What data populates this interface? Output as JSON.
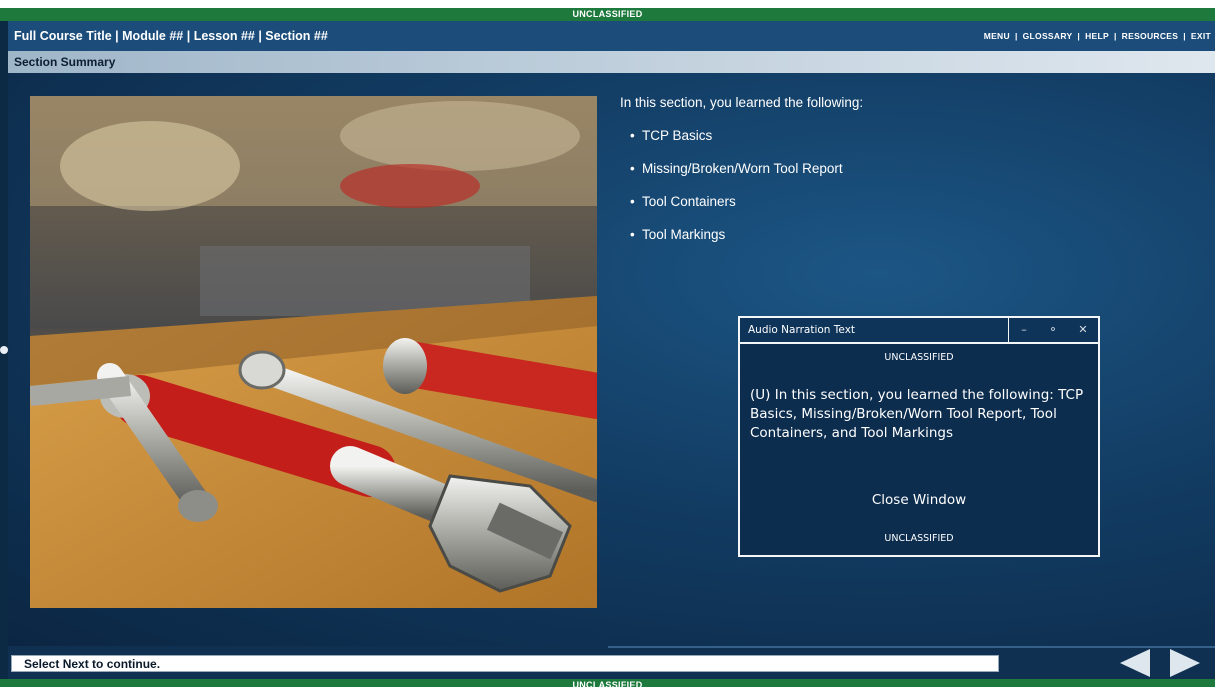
{
  "classification": {
    "top": "UNCLASSIFIED",
    "bottom": "UNCLASSIFIED"
  },
  "header": {
    "course_title": "Full Course Title | Module ## | Lesson ## | Section ##",
    "nav": [
      "MENU",
      "GLOSSARY",
      "HELP",
      "RESOURCES",
      "EXIT"
    ],
    "nav_separator": "|"
  },
  "section": {
    "title": "Section Summary"
  },
  "content": {
    "intro": "In this section, you learned the following:",
    "bullets": [
      "TCP Basics",
      "Missing/Broken/Worn Tool Report",
      "Tool Containers",
      "Tool Markings"
    ],
    "bullet_glyph": "•"
  },
  "dialog": {
    "title": "Audio Narration Text",
    "classification_top": "UNCLASSIFIED",
    "classification_bottom": "UNCLASSIFIED",
    "body": "(U) In this section, you learned the following: TCP Basics, Missing/Broken/Worn Tool Report, Tool Containers, and Tool Markings",
    "close_label": "Close Window",
    "minimize_glyph": "–",
    "restore_glyph": "⚬",
    "close_glyph": "✕"
  },
  "footer": {
    "status_text": "Select Next to continue."
  },
  "icons": {
    "prev": "back-arrow-icon",
    "next": "next-arrow-icon"
  },
  "colors": {
    "banner": "#1d7a3c",
    "titlebar": "#1c4d7a",
    "stage": "#123c63",
    "accent": "#dfe7ee"
  }
}
